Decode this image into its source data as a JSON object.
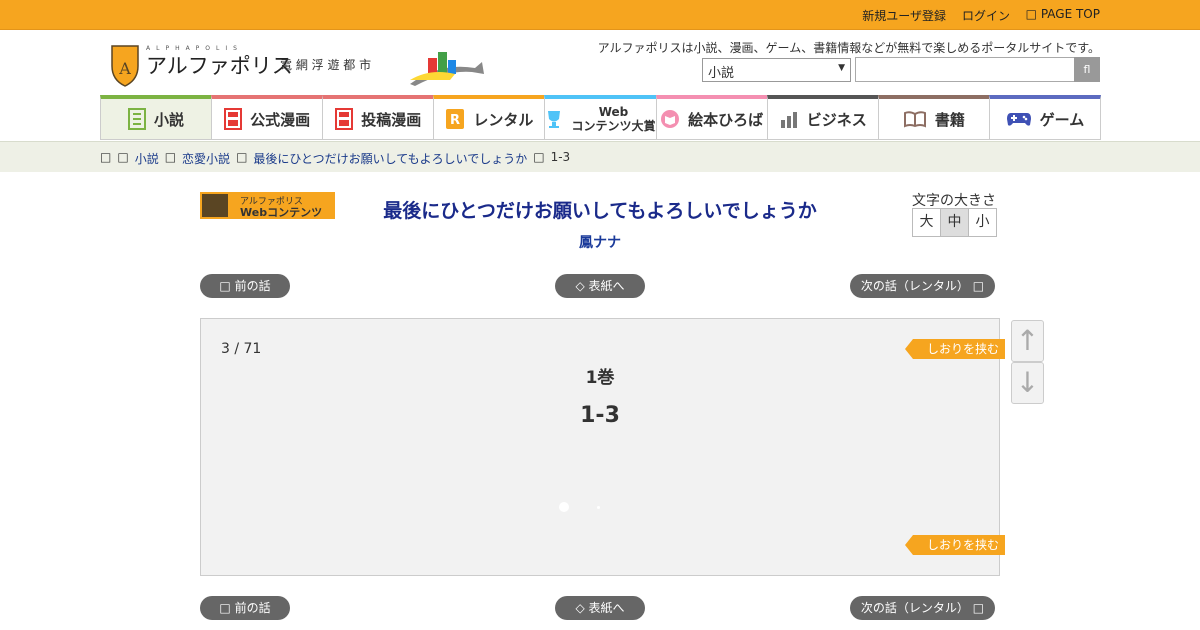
{
  "topbar": {
    "register": "新規ユーザ登録",
    "login": "ログイン",
    "pagetop": "PAGE TOP"
  },
  "header": {
    "logo_main": "アルファポリス",
    "logo_sub": "電 網 浮 遊 都 市",
    "portal_text": "アルファポリスは小説、漫画、ゲーム、書籍情報などが無料で楽しめるポータルサイトです。",
    "select_value": "小説",
    "search_button": "fl"
  },
  "nav": [
    {
      "label": "小説",
      "color": "#7cb342",
      "icon": "book-icon"
    },
    {
      "label": "公式漫画",
      "color": "#e57373",
      "icon": "manga-icon"
    },
    {
      "label": "投稿漫画",
      "color": "#e57373",
      "icon": "manga-icon"
    },
    {
      "label": "レンタル",
      "color": "#f6a51f",
      "icon": "rental-icon"
    },
    {
      "label1": "Web",
      "label2": "コンテンツ大賞",
      "color": "#4fc3f7",
      "icon": "trophy-icon"
    },
    {
      "label": "絵本ひろば",
      "color": "#f48fb1",
      "icon": "picture-book-icon"
    },
    {
      "label": "ビジネス",
      "color": "#555555",
      "icon": "chart-icon"
    },
    {
      "label": "書籍",
      "color": "#8d6e63",
      "icon": "open-book-icon"
    },
    {
      "label": "ゲーム",
      "color": "#5c6bc0",
      "icon": "gamepad-icon"
    }
  ],
  "breadcrumb": {
    "home": "",
    "sep": "",
    "novel": "小説",
    "genre": "恋愛小説",
    "work": "最後にひとつだけお願いしてもよろしいでしょうか",
    "episode": "1-3"
  },
  "badge": {
    "line1": "アルファポリス",
    "line2": "Webコンテンツ"
  },
  "work": {
    "title": "最後にひとつだけお願いしてもよろしいでしょうか",
    "author": "鳳ナナ"
  },
  "fontsize": {
    "label": "文字の大きさ",
    "large": "大",
    "medium": "中",
    "small": "小"
  },
  "pager": {
    "prev": " 前の話",
    "cover": "◇ 表紙へ",
    "next": "次の話（レンタル） "
  },
  "reader": {
    "page": "3 / 71",
    "volume": "1巻",
    "episode": "1-3",
    "bookmark": "しおりを挟む"
  }
}
